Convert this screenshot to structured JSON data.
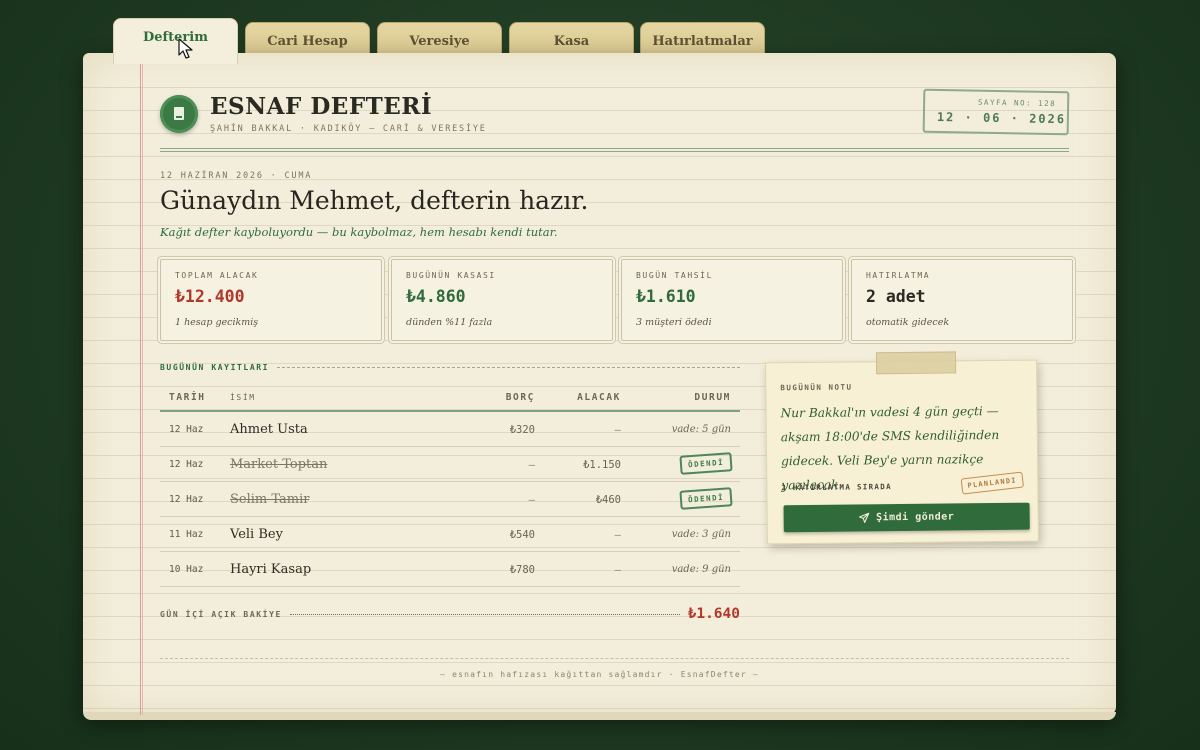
{
  "tabs": [
    {
      "label": "Defterim",
      "active": true
    },
    {
      "label": "Cari Hesap"
    },
    {
      "label": "Veresiye"
    },
    {
      "label": "Kasa"
    },
    {
      "label": "Hatırlatmalar"
    }
  ],
  "header": {
    "title": "ESNAF DEFTERİ",
    "subtitle": "ŞAHİN BAKKAL · KADIKÖY — CARİ & VERESİYE",
    "logo_icon": "ledger-book-icon",
    "page_number": "SAYFA NO: 128",
    "date_stamp": "12 · 06 · 2026"
  },
  "intro": {
    "date_line": "12 HAZİRAN 2026 · CUMA",
    "greeting": "Günaydın Mehmet, defterin hazır.",
    "tagline": "Kağıt defter kayboluyordu — bu kaybolmaz, hem hesabı kendi tutar."
  },
  "stats": [
    {
      "label": "TOPLAM ALACAK",
      "value": "₺12.400",
      "note": "1 hesap gecikmiş",
      "color": "#b0392b"
    },
    {
      "label": "BUGÜNÜN KASASI",
      "value": "₺4.860",
      "note": "dünden %11 fazla",
      "color": "#2f6b3b"
    },
    {
      "label": "BUGÜN TAHSİL",
      "value": "₺1.610",
      "note": "3 müşteri ödedi",
      "color": "#2f6b3b"
    },
    {
      "label": "HATIRLATMA",
      "value": "2 adet",
      "note": "otomatik gidecek",
      "color": "#2a2a22"
    }
  ],
  "records": {
    "section_title": "BUGÜNÜN KAYITLARI",
    "columns": {
      "date": "TARİH",
      "name": "İSİM",
      "borc": "BORÇ",
      "alacak": "ALACAK",
      "durum": "DURUM"
    },
    "rows": [
      {
        "date": "12 Haz",
        "name": "Ahmet Usta",
        "borc": "₺320",
        "alacak": "—",
        "durum": "vade: 5 gün"
      },
      {
        "date": "12 Haz",
        "name": "Market Toptan",
        "borc": "—",
        "alacak": "₺1.150",
        "durum": "ÖDENDİ"
      },
      {
        "date": "12 Haz",
        "name": "Selim Tamir",
        "borc": "—",
        "alacak": "₺460",
        "durum": "ÖDENDİ"
      },
      {
        "date": "11 Haz",
        "name": "Veli Bey",
        "borc": "₺540",
        "alacak": "—",
        "durum": "vade: 3 gün"
      },
      {
        "date": "10 Haz",
        "name": "Hayri Kasap",
        "borc": "₺780",
        "alacak": "—",
        "durum": "vade: 9 gün"
      }
    ],
    "balance_label": "GÜN İÇİ AÇIK BAKİYE",
    "balance_value": "₺1.640"
  },
  "note": {
    "label": "BUGÜNÜN NOTU",
    "text": "Nur Bakkal'ın vadesi 4 gün geçti — akşam 18:00'de SMS kendiliğinden gidecek. Veli Bey'e yarın nazikçe yazılacak.",
    "count": "2 HATIRLATMA SIRADA",
    "badge": "PLANLANDI",
    "button": "Şimdi gönder",
    "button_icon": "send-icon"
  },
  "footer": "— esnafın hafızası kağıttan sağlamdır · EsnafDefter —"
}
